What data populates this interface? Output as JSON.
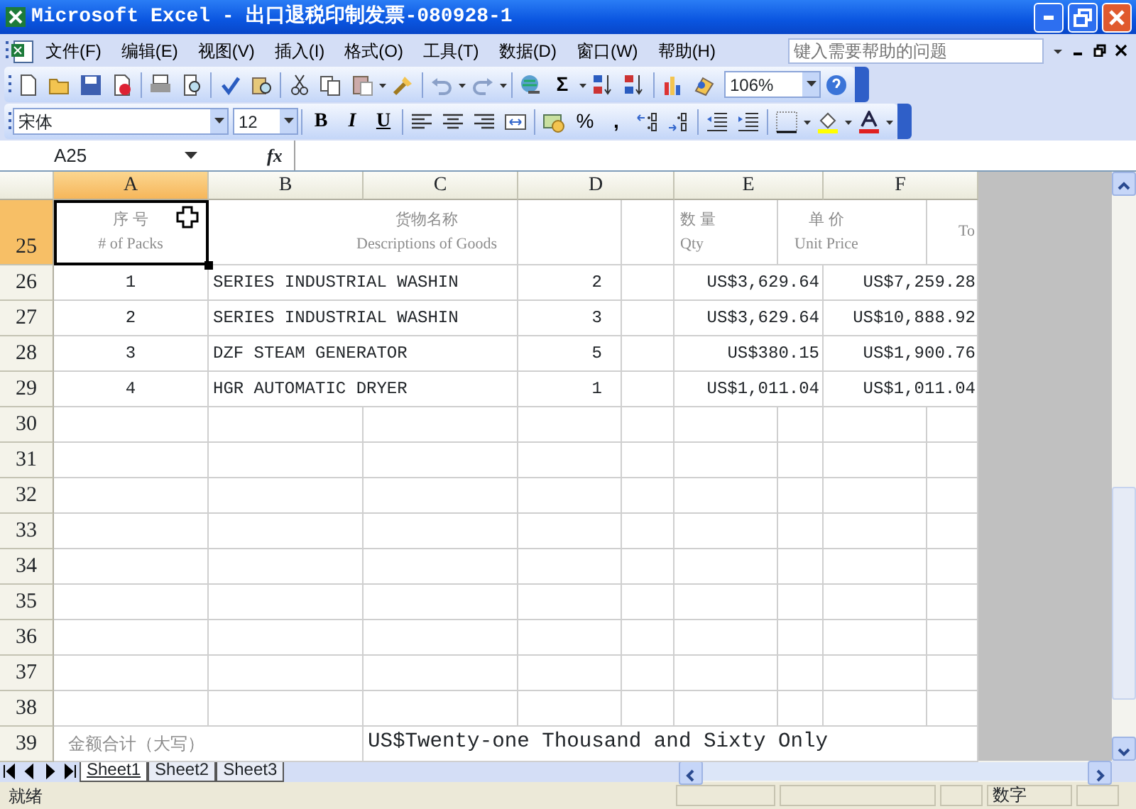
{
  "window": {
    "title": "Microsoft Excel - 出口退税印制发票-080928-1"
  },
  "menu": {
    "items": [
      "文件(F)",
      "编辑(E)",
      "视图(V)",
      "插入(I)",
      "格式(O)",
      "工具(T)",
      "数据(D)",
      "窗口(W)",
      "帮助(H)"
    ],
    "help_box": {
      "placeholder": "键入需要帮助的问题"
    }
  },
  "standard_toolbar": {
    "autosum": "Σ",
    "zoom": "106%"
  },
  "formatting_toolbar": {
    "font": "宋体",
    "size": "12",
    "bold": "B",
    "italic": "I",
    "underline": "U",
    "percent": "%",
    "comma": ","
  },
  "formula_bar": {
    "name_box": "A25",
    "function_label": "fx"
  },
  "sheet": {
    "columns": [
      {
        "label": "A",
        "selected": true
      },
      {
        "label": "B",
        "selected": false
      },
      {
        "label": "C",
        "selected": false
      },
      {
        "label": "D",
        "selected": false
      },
      {
        "label": "E",
        "selected": false
      },
      {
        "label": "F",
        "selected": false
      }
    ],
    "rows": [
      {
        "header": "25",
        "selected": true,
        "kind": "heading",
        "packs": {
          "zh": "序 号",
          "en": "# of Packs"
        },
        "goods": {
          "zh": "货物名称",
          "en": "Descriptions of Goods"
        },
        "qty": {
          "zh": "数 量",
          "en": "Qty"
        },
        "price": {
          "zh": "单 价",
          "en": "Unit Price"
        },
        "column_10": "To"
      },
      {
        "header": "26",
        "selected": false,
        "kind": "item",
        "a": "1",
        "b": "SERIES INDUSTRIAL WASHIN",
        "d": "2",
        "e": "US$3,629.64",
        "f": "US$7,259.28"
      },
      {
        "header": "27",
        "selected": false,
        "kind": "item",
        "a": "2",
        "b": "SERIES INDUSTRIAL WASHIN",
        "d": "3",
        "e": "US$3,629.64",
        "f": "US$10,888.92"
      },
      {
        "header": "28",
        "selected": false,
        "kind": "item",
        "a": "3",
        "b": "DZF STEAM GENERATOR",
        "d": "5",
        "e": "US$380.15",
        "f": "US$1,900.76"
      },
      {
        "header": "29",
        "selected": false,
        "kind": "item",
        "a": "4",
        "b": "HGR AUTOMATIC DRYER",
        "d": "1",
        "e": "US$1,011.04",
        "f": "US$1,011.04"
      },
      {
        "header": "30",
        "selected": false,
        "kind": "blank"
      },
      {
        "header": "31",
        "selected": false,
        "kind": "blank"
      },
      {
        "header": "32",
        "selected": false,
        "kind": "blank"
      },
      {
        "header": "33",
        "selected": false,
        "kind": "blank"
      },
      {
        "header": "34",
        "selected": false,
        "kind": "blank"
      },
      {
        "header": "35",
        "selected": false,
        "kind": "blank"
      },
      {
        "header": "36",
        "selected": false,
        "kind": "blank"
      },
      {
        "header": "37",
        "selected": false,
        "kind": "blank"
      },
      {
        "header": "38",
        "selected": false,
        "kind": "blank"
      },
      {
        "header": "39",
        "selected": false,
        "kind": "total",
        "label": "金额合计（大写）",
        "amount_words": "US$Twenty-one Thousand and Sixty Only"
      }
    ]
  },
  "sheet_tabs": [
    {
      "label": "Sheet1",
      "selected": true
    },
    {
      "label": "Sheet2",
      "selected": false
    },
    {
      "label": "Sheet3",
      "selected": false
    }
  ],
  "status_bar": {
    "mode": "就绪",
    "indicator": "数字"
  }
}
